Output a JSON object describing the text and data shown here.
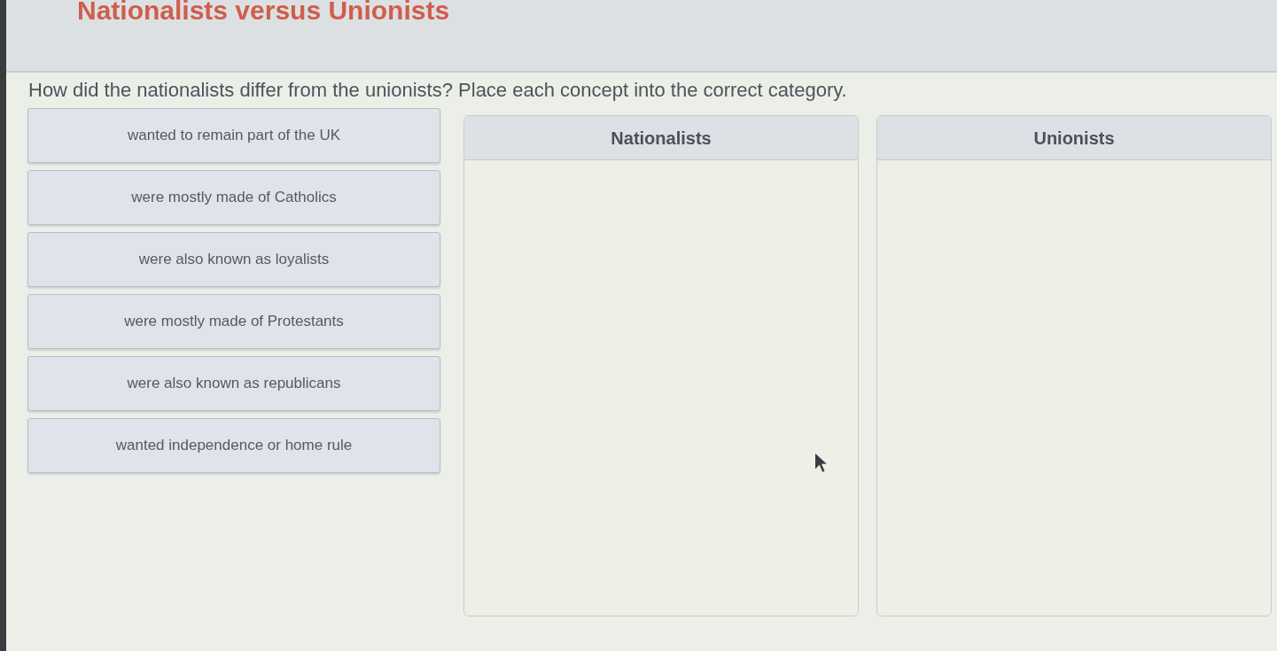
{
  "title": "Nationalists versus Unionists",
  "prompt": "How did the nationalists differ from the unionists? Place each concept into the correct category.",
  "concepts": [
    "wanted to remain part of the UK",
    "were mostly made of Catholics",
    "were also known as loyalists",
    "were mostly made of Protestants",
    "were also known as republicans",
    "wanted independence or home rule"
  ],
  "categories": [
    {
      "name": "Nationalists"
    },
    {
      "name": "Unionists"
    }
  ]
}
